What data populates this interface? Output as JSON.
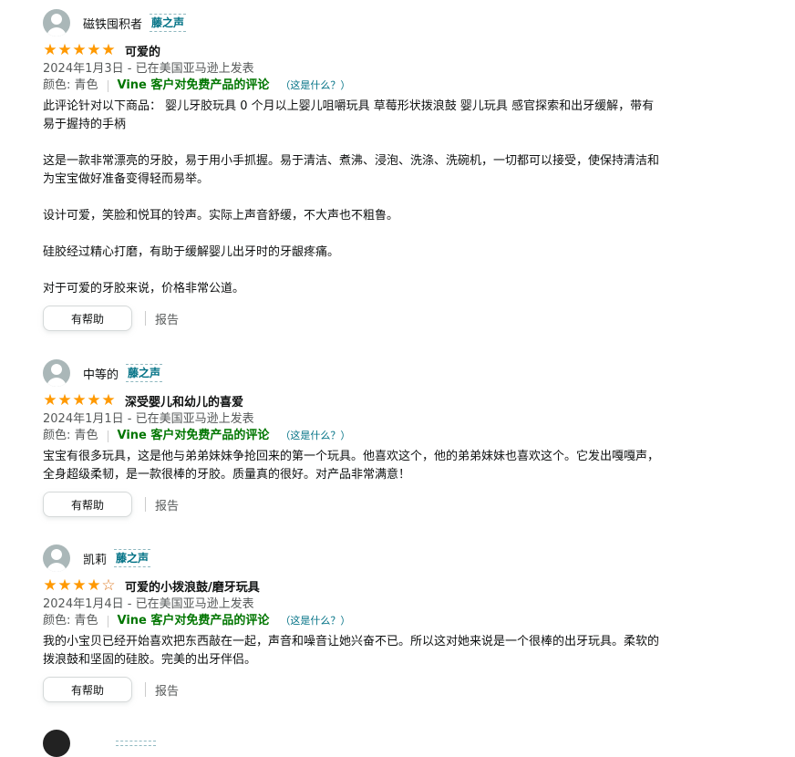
{
  "reviews": [
    {
      "reviewer": "磁铁囤积者",
      "badge": "藤之声",
      "rating": 5,
      "title": "可爱的",
      "date": "2024年1月3日 - 已在美国亚马逊上发表",
      "color": "颜色: 青色",
      "vine_label": "Vine 客户对免费产品的评论",
      "what_is_this": "（这是什么？）",
      "paragraphs": [
        "此评论针对以下商品： 婴儿牙胶玩具 0 个月以上婴儿咀嚼玩具 草莓形状拨浪鼓 婴儿玩具 感官探索和出牙缓解，带有易于握持的手柄",
        "这是一款非常漂亮的牙胶，易于用小手抓握。易于清洁、煮沸、浸泡、洗涤、洗碗机，一切都可以接受，使保持清洁和为宝宝做好准备变得轻而易举。",
        "设计可爱，笑脸和悦耳的铃声。实际上声音舒缓，不大声也不粗鲁。",
        "硅胶经过精心打磨，有助于缓解婴儿出牙时的牙龈疼痛。",
        "对于可爱的牙胶来说，价格非常公道。"
      ],
      "helpful": "有帮助",
      "report": "报告"
    },
    {
      "reviewer": "中等的",
      "badge": "藤之声",
      "rating": 5,
      "title": "深受婴儿和幼儿的喜爱",
      "date": "2024年1月1日 - 已在美国亚马逊上发表",
      "color": "颜色: 青色",
      "vine_label": "Vine 客户对免费产品的评论",
      "what_is_this": "（这是什么？）",
      "paragraphs": [
        "宝宝有很多玩具，这是他与弟弟妹妹争抢回来的第一个玩具。他喜欢这个，他的弟弟妹妹也喜欢这个。它发出嘎嘎声，全身超级柔韧，是一款很棒的牙胶。质量真的很好。对产品非常满意！"
      ],
      "helpful": "有帮助",
      "report": "报告"
    },
    {
      "reviewer": "凯莉",
      "badge": "藤之声",
      "rating": 4,
      "title": "可爱的小拨浪鼓/磨牙玩具",
      "date": "2024年1月4日 - 已在美国亚马逊上发表",
      "color": "颜色: 青色",
      "vine_label": "Vine 客户对免费产品的评论",
      "what_is_this": "（这是什么？）",
      "paragraphs": [
        "我的小宝贝已经开始喜欢把东西敲在一起，声音和噪音让她兴奋不已。所以这对她来说是一个很棒的出牙玩具。柔软的拨浪鼓和坚固的硅胶。完美的出牙伴侣。"
      ],
      "helpful": "有帮助",
      "report": "报告"
    }
  ],
  "icons": {
    "star_filled": "star-filled-icon",
    "star_empty": "star-empty-icon",
    "avatar": "default-avatar-icon"
  },
  "colors": {
    "star": "#ff9900",
    "vine_green": "#007600",
    "link_teal": "#007185"
  }
}
